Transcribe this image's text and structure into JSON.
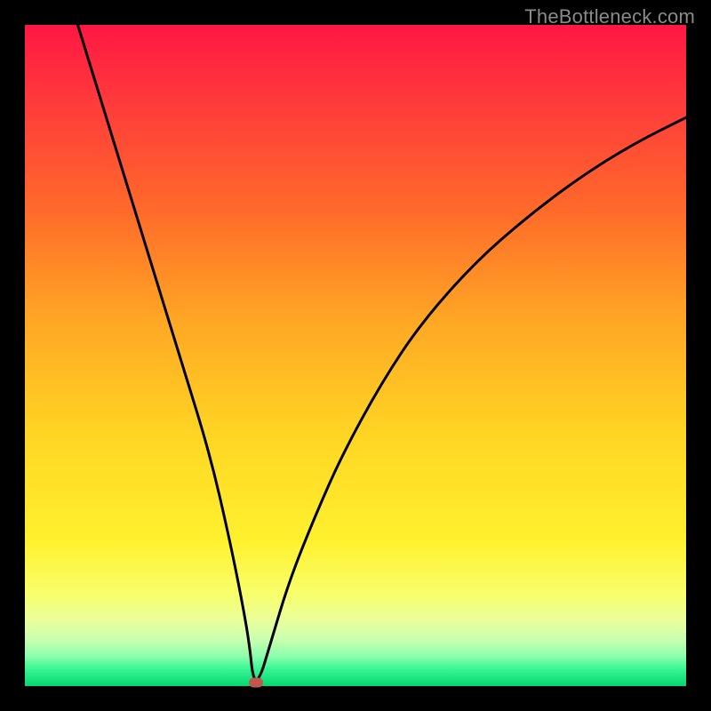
{
  "watermark": "TheBottleneck.com",
  "chart_data": {
    "type": "line",
    "title": "",
    "xlabel": "",
    "ylabel": "",
    "xlim": [
      0,
      100
    ],
    "ylim": [
      0,
      100
    ],
    "grid": false,
    "legend": false,
    "series": [
      {
        "name": "curve",
        "x": [
          8,
          12,
          16,
          20,
          24,
          28,
          31,
          33,
          34,
          34.5,
          35.5,
          37,
          40,
          44,
          48,
          54,
          60,
          68,
          76,
          84,
          92,
          100
        ],
        "y": [
          100,
          87,
          74,
          61,
          48,
          35,
          22,
          12,
          6,
          1,
          1,
          6,
          16,
          26,
          35,
          46,
          55,
          64,
          71,
          77,
          82,
          86
        ]
      }
    ],
    "marker": {
      "x": 35,
      "y": 0.5
    },
    "background_gradient": {
      "stops": [
        {
          "pos": 0.0,
          "color": "#ff1744"
        },
        {
          "pos": 0.12,
          "color": "#ff3b3b"
        },
        {
          "pos": 0.28,
          "color": "#ff6a2a"
        },
        {
          "pos": 0.45,
          "color": "#ffa824"
        },
        {
          "pos": 0.62,
          "color": "#ffd524"
        },
        {
          "pos": 0.78,
          "color": "#fff12e"
        },
        {
          "pos": 0.86,
          "color": "#f8ff6a"
        },
        {
          "pos": 0.9,
          "color": "#eaff9a"
        },
        {
          "pos": 0.93,
          "color": "#c9ffb0"
        },
        {
          "pos": 0.955,
          "color": "#8affad"
        },
        {
          "pos": 0.975,
          "color": "#35f592"
        },
        {
          "pos": 1.0,
          "color": "#06d66f"
        }
      ]
    }
  }
}
